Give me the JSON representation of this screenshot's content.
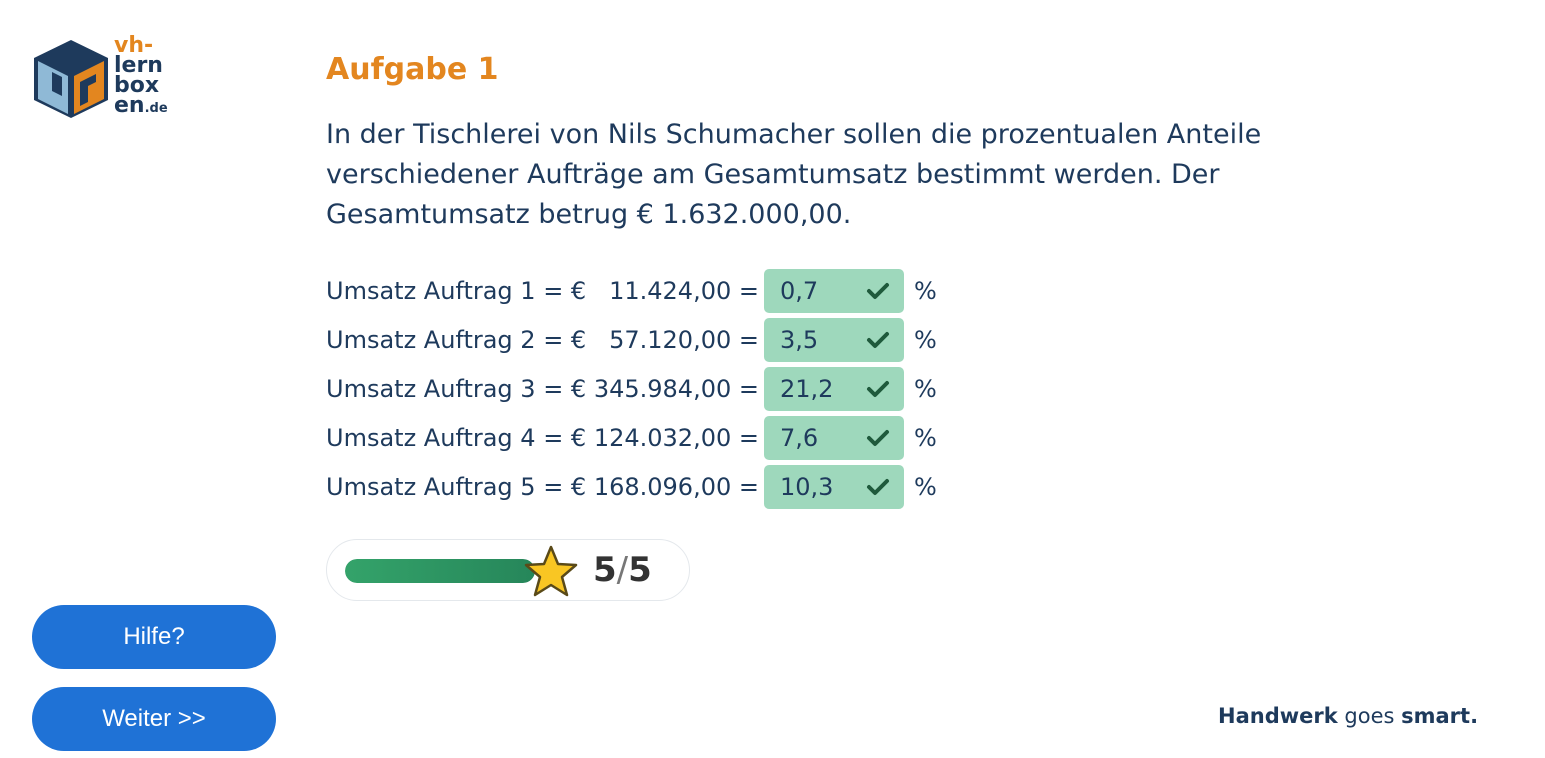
{
  "logo": {
    "line1": "vh-",
    "line2": "lern",
    "line3": "box",
    "line4": "en",
    "tld": ".de"
  },
  "task": {
    "title": "Aufgabe 1",
    "intro": "In der Tischlerei von Nils Schumacher sollen die prozentualen Anteile verschiedener Aufträge am Gesamtumsatz bestimmt werden. Der Gesamtumsatz betrug € 1.632.000,00."
  },
  "rows": [
    {
      "label": "Umsatz Auftrag 1 = €   11.424,00 =",
      "value": "0,7",
      "unit": "%"
    },
    {
      "label": "Umsatz Auftrag 2 = €   57.120,00 =",
      "value": "3,5",
      "unit": "%"
    },
    {
      "label": "Umsatz Auftrag 3 = € 345.984,00 =",
      "value": "21,2",
      "unit": "%"
    },
    {
      "label": "Umsatz Auftrag 4 = € 124.032,00 =",
      "value": "7,6",
      "unit": "%"
    },
    {
      "label": "Umsatz Auftrag 5 = € 168.096,00 =",
      "value": "10,3",
      "unit": "%"
    }
  ],
  "progress": {
    "score": "5",
    "sep": "/",
    "total": "5",
    "fraction": 1.0
  },
  "buttons": {
    "help": "Hilfe?",
    "next": "Weiter >>"
  },
  "tagline": {
    "part1": "Handwerk",
    "part2": "goes",
    "part3": "smart."
  },
  "colors": {
    "accent": "#e3861f",
    "primary": "#1f72d6",
    "correct": "#9ed8bc",
    "text": "#1e3a5c"
  }
}
